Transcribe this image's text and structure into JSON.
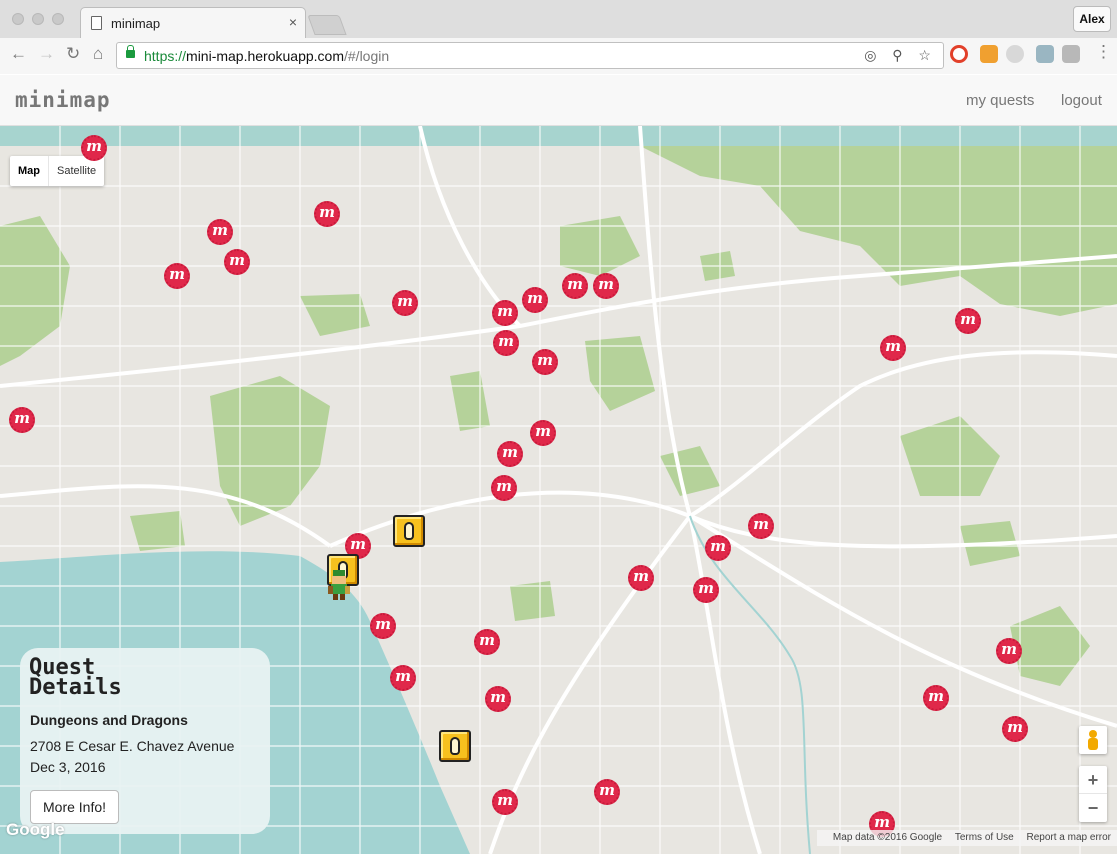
{
  "browser": {
    "tab_title": "minimap",
    "tab_close": "×",
    "profile_name": "Alex",
    "url_scheme": "https://",
    "url_host": "mini-map.herokuapp.com",
    "url_path": "/#/login",
    "nav": {
      "back": "←",
      "forward": "→",
      "reload": "↻",
      "home": "⌂"
    },
    "omni_icons": "◎ ⚲ ☆"
  },
  "app": {
    "brand": "minimap",
    "nav_my_quests": "my quests",
    "nav_logout": "logout"
  },
  "map": {
    "type_map": "Map",
    "type_satellite": "Satellite",
    "zoom_in": "+",
    "zoom_out": "−",
    "google": "Google",
    "map_data": "Map data ©2016 Google",
    "terms": "Terms of Use",
    "report": "Report a map error",
    "marker_glyph": "m",
    "marker_color": "#e0284a",
    "quest_block_color": "#f7c11e",
    "water_color": "#a3d3d2",
    "park_color": "#b5d29a"
  },
  "quest_details": {
    "heading_line1": "Quest",
    "heading_line2": "Details",
    "name": "Dungeons and Dragons",
    "address": "2708 E Cesar E. Chavez Avenue",
    "date": "Dec 3, 2016",
    "more_button": "More Info!"
  }
}
